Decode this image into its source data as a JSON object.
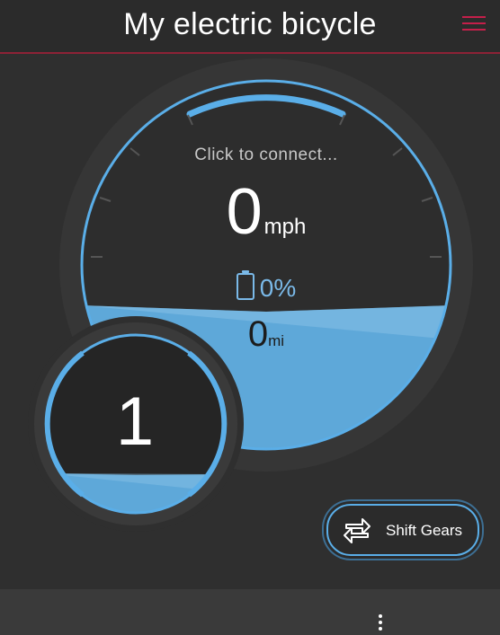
{
  "header": {
    "title": "My electric bicycle",
    "menu_icon": "hamburger-menu-icon"
  },
  "speedometer": {
    "status_text": "Click to connect...",
    "speed_value": "0",
    "speed_unit": "mph",
    "battery_icon": "battery-icon",
    "battery_text": "0%",
    "distance_value": "0",
    "distance_unit": "mi"
  },
  "gear": {
    "value": "1"
  },
  "shift_gears": {
    "label": "Shift Gears",
    "icon": "swap-arrows-icon"
  },
  "bottom_bar": {
    "overflow_icon": "more-vert-icon"
  },
  "colors": {
    "accent_blue": "#5aaee8",
    "header_rule": "#8d2236",
    "menu_red": "#c51f4a"
  }
}
